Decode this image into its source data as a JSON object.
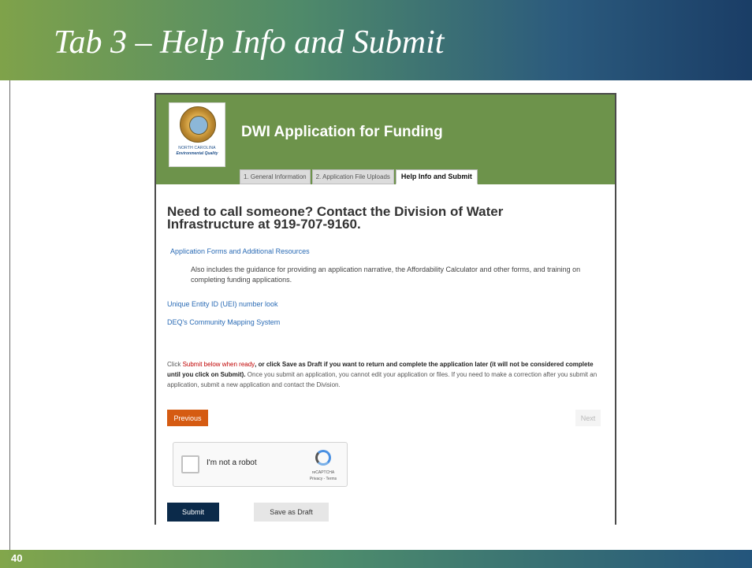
{
  "slide": {
    "title": "Tab 3 – Help Info and Submit",
    "page_number": "40"
  },
  "app": {
    "logo": {
      "line1": "NORTH CAROLINA",
      "line2": "Environmental Quality"
    },
    "title": "DWI Application for Funding",
    "tabs": [
      {
        "label": "1. General Information",
        "active": false
      },
      {
        "label": "2. Application File Uploads",
        "active": false
      },
      {
        "label": "Help Info and Submit",
        "active": true
      }
    ]
  },
  "content": {
    "headline": "Need to call someone? Contact the Division of Water Infrastructure at 919-707-9160.",
    "links": {
      "forms": "Application Forms and Additional Resources",
      "uei": "Unique Entity ID (UEI) number look",
      "mapping": "DEQ's Community Mapping System"
    },
    "forms_description": "Also includes the guidance for providing an application narrative, the Affordability Calculator and other forms, and training on completing funding applications.",
    "notice": {
      "part1": "Click ",
      "part2": "Submit below when ready",
      "part3": ", or click Save as Draft if you want to return and complete the application later (it will not be considered complete until you click on Submit).",
      "part4": " Once you submit an application, you cannot edit your application or files. If you need to make a correction after you submit an application, submit a new application and contact the Division."
    },
    "buttons": {
      "previous": "Previous",
      "next": "Next",
      "submit": "Submit",
      "save_draft": "Save as Draft"
    },
    "captcha": {
      "label": "I'm not a robot",
      "brand": "reCAPTCHA",
      "terms": "Privacy - Terms"
    }
  }
}
